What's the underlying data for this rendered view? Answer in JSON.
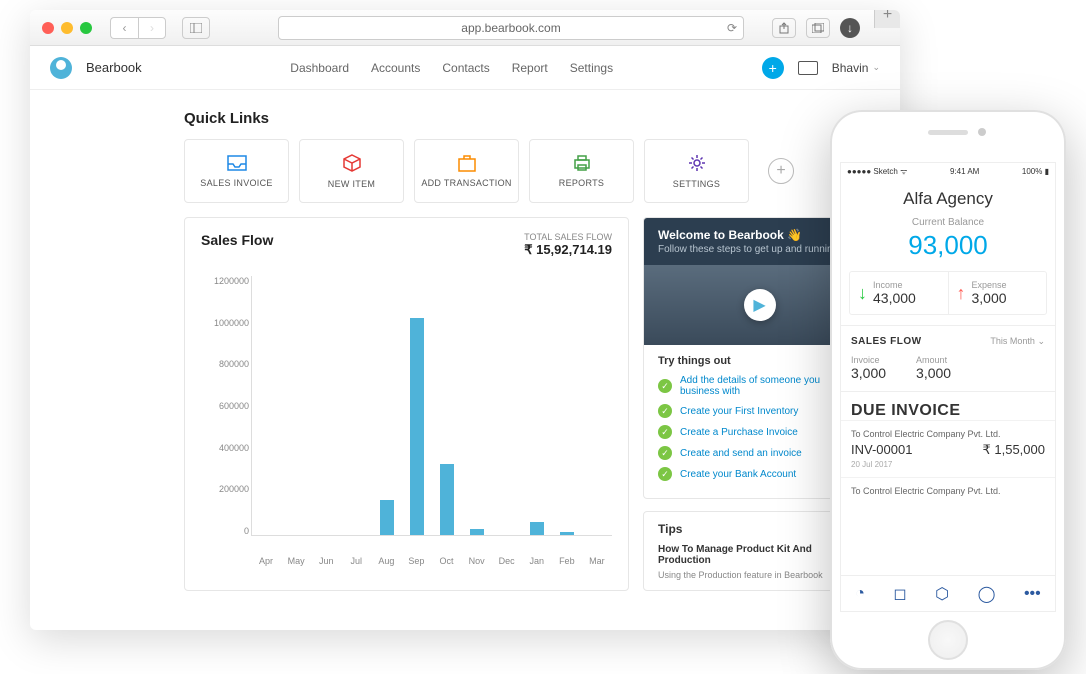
{
  "browser": {
    "url": "app.bearbook.com"
  },
  "app": {
    "name": "Bearbook",
    "nav": [
      "Dashboard",
      "Accounts",
      "Contacts",
      "Report",
      "Settings"
    ],
    "user": "Bhavin"
  },
  "quick_links": {
    "title": "Quick Links",
    "items": [
      {
        "label": "SALES INVOICE",
        "icon": "inbox",
        "color": "#1e88e5"
      },
      {
        "label": "NEW ITEM",
        "icon": "box",
        "color": "#e53935"
      },
      {
        "label": "ADD TRANSACTION",
        "icon": "briefcase",
        "color": "#fb8c00"
      },
      {
        "label": "REPORTS",
        "icon": "printer",
        "color": "#43a047"
      },
      {
        "label": "SETTINGS",
        "icon": "gear",
        "color": "#5e35b1"
      }
    ]
  },
  "sales_flow": {
    "title": "Sales Flow",
    "total_label": "TOTAL SALES FLOW",
    "total_value": "₹ 15,92,714.19"
  },
  "chart_data": {
    "type": "bar",
    "title": "Sales Flow",
    "categories": [
      "Apr",
      "May",
      "Jun",
      "Jul",
      "Aug",
      "Sep",
      "Oct",
      "Nov",
      "Dec",
      "Jan",
      "Feb",
      "Mar"
    ],
    "values": [
      0,
      0,
      0,
      0,
      160000,
      1000000,
      330000,
      30000,
      0,
      60000,
      12000,
      0
    ],
    "ylim": [
      0,
      1200000
    ],
    "y_ticks": [
      0,
      200000,
      400000,
      600000,
      800000,
      1000000,
      1200000
    ],
    "xlabel": "",
    "ylabel": ""
  },
  "welcome": {
    "title": "Welcome to Bearbook 👋",
    "subtitle": "Follow these steps to get up and running",
    "try_title": "Try things out",
    "items": [
      "Add the details of someone you business with",
      "Create your First Inventory",
      "Create a Purchase Invoice",
      "Create and send an invoice",
      "Create your Bank Account"
    ]
  },
  "tips": {
    "title": "Tips",
    "headline": "How To Manage Product Kit And Production",
    "body": "Using the Production feature in Bearbook"
  },
  "phone": {
    "status_left": "Sketch",
    "status_time": "9:41 AM",
    "status_right": "100%",
    "title": "Alfa Agency",
    "balance_label": "Current Balance",
    "balance": "93,000",
    "income_label": "Income",
    "income": "43,000",
    "expense_label": "Expense",
    "expense": "3,000",
    "sales_flow_title": "SALES FLOW",
    "sales_filter": "This Month",
    "invoice_label": "Invoice",
    "invoice_val": "3,000",
    "amount_label": "Amount",
    "amount_val": "3,000",
    "due_title": "DUE INVOICE",
    "invoices": [
      {
        "to": "To Control Electric Company Pvt. Ltd.",
        "id": "INV-00001",
        "amount": "₹ 1,55,000",
        "date": "20 Jul 2017"
      },
      {
        "to": "To Control Electric Company Pvt. Ltd.",
        "id": "",
        "amount": "",
        "date": ""
      }
    ]
  }
}
